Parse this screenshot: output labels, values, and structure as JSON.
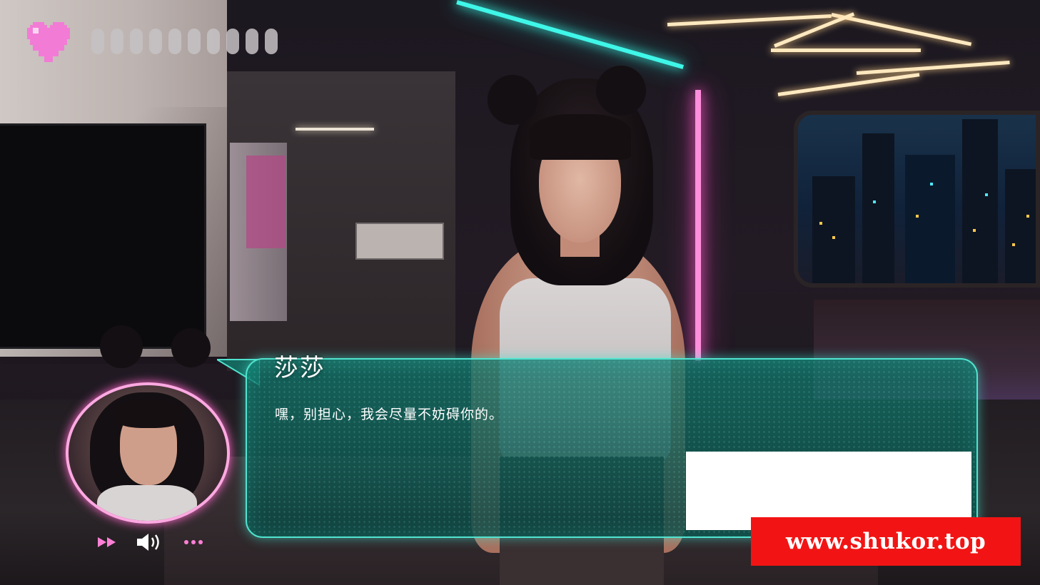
{
  "hud": {
    "heart_icon": "pixel-heart-icon",
    "heart_color": "#f27bd6",
    "pill_count": 10
  },
  "dialogue": {
    "speaker": "莎莎",
    "text": "嘿，别担心，我会尽量不妨碍你的。",
    "box_color": "#1a8c80",
    "border_color": "#51e3cf"
  },
  "controls": {
    "skip_icon": "fast-forward-icon",
    "voice_icon": "speaker-icon",
    "menu_icon": "ellipsis-icon",
    "color": "#ff7fd6"
  },
  "overlay": {
    "watermark_text": "www.shukor.top"
  }
}
